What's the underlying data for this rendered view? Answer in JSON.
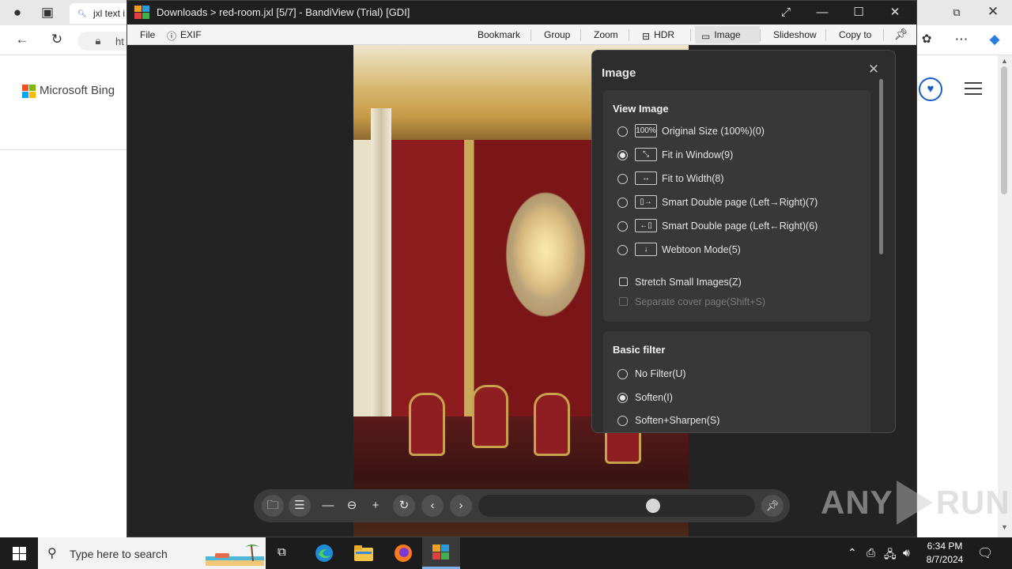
{
  "browser": {
    "tab_title": "jxl text i",
    "address_fragment": "ht",
    "bing_logo_text": "Microsoft Bing"
  },
  "viewer": {
    "window_title": "Downloads > red-room.jxl [5/7] - BandiView (Trial) [GDI]",
    "menu": {
      "file": "File",
      "exif": "EXIF",
      "bookmark": "Bookmark",
      "group": "Group",
      "zoom": "Zoom",
      "hdr": "HDR",
      "image": "Image",
      "slideshow": "Slideshow",
      "copy_to": "Copy to"
    },
    "slider_position": 0.64
  },
  "image_panel": {
    "title": "Image",
    "view_image": {
      "title": "View Image",
      "options": [
        {
          "icon": "100%",
          "label": "Original Size (100%)(0)",
          "selected": false
        },
        {
          "icon": "fit-window",
          "label": "Fit in Window(9)",
          "selected": true
        },
        {
          "icon": "fit-width",
          "label": "Fit to Width(8)",
          "selected": false
        },
        {
          "icon": "double-lr",
          "label": "Smart Double page (Left→Right)(7)",
          "selected": false
        },
        {
          "icon": "double-rl",
          "label": "Smart Double page (Left←Right)(6)",
          "selected": false
        },
        {
          "icon": "webtoon",
          "label": "Webtoon Mode(5)",
          "selected": false
        }
      ],
      "stretch_small_images": "Stretch Small Images(Z)",
      "separate_cover_page": "Separate cover page(Shift+S)"
    },
    "basic_filter": {
      "title": "Basic filter",
      "options": [
        {
          "label": "No Filter(U)",
          "selected": false
        },
        {
          "label": "Soften(I)",
          "selected": true
        },
        {
          "label": "Soften+Sharpen(S)",
          "selected": false
        }
      ]
    }
  },
  "watermark": {
    "left": "ANY",
    "right": "RUN"
  },
  "taskbar": {
    "search_placeholder": "Type here to search",
    "time": "6:34 PM",
    "date": "8/7/2024"
  },
  "colors": {
    "viewer_bg": "#232323",
    "panel_bg": "#2d2d2d",
    "section_bg": "#383838",
    "taskbar_bg": "#1c1c1c",
    "edge_blue": "#1a5dc8"
  }
}
